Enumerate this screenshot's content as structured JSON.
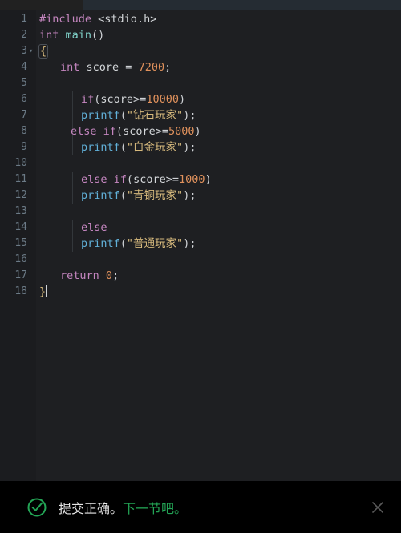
{
  "window": {
    "tab_active_label": "",
    "background": "#1e1f22",
    "gutter_background": "#1b1c1f"
  },
  "editor": {
    "language": "c",
    "cursor_line": 18,
    "lines": [
      {
        "number": "1",
        "fold": "",
        "indent": 0,
        "guides": [],
        "tokens": [
          {
            "text": "#include",
            "cls": "k-pre"
          },
          {
            "text": " ",
            "cls": "k-punc"
          },
          {
            "text": "<stdio.h>",
            "cls": "k-inc"
          }
        ]
      },
      {
        "number": "2",
        "fold": "",
        "indent": 0,
        "guides": [],
        "tokens": [
          {
            "text": "int",
            "cls": "k-kw"
          },
          {
            "text": " ",
            "cls": "k-punc"
          },
          {
            "text": "main",
            "cls": "k-type"
          },
          {
            "text": "()",
            "cls": "k-punc"
          }
        ]
      },
      {
        "number": "3",
        "fold": "▾",
        "indent": 0,
        "guides": [],
        "tokens": [
          {
            "text": "{",
            "cls": "k-br1 brace-box"
          }
        ]
      },
      {
        "number": "4",
        "fold": "",
        "indent": 1,
        "guides": [],
        "tokens": [
          {
            "text": "int",
            "cls": "k-kw"
          },
          {
            "text": " ",
            "cls": "k-punc"
          },
          {
            "text": "score",
            "cls": "k-id"
          },
          {
            "text": " = ",
            "cls": "k-punc"
          },
          {
            "text": "7200",
            "cls": "k-num"
          },
          {
            "text": ";",
            "cls": "k-punc"
          }
        ]
      },
      {
        "number": "5",
        "fold": "",
        "indent": 0,
        "guides": [],
        "tokens": []
      },
      {
        "number": "6",
        "fold": "",
        "indent": 2,
        "guides": [
          "g1"
        ],
        "tokens": [
          {
            "text": "if",
            "cls": "k-kw"
          },
          {
            "text": "(",
            "cls": "k-punc"
          },
          {
            "text": "score",
            "cls": "k-id"
          },
          {
            "text": ">=",
            "cls": "k-punc"
          },
          {
            "text": "10000",
            "cls": "k-num"
          },
          {
            "text": ")",
            "cls": "k-punc"
          }
        ]
      },
      {
        "number": "7",
        "fold": "",
        "indent": 2,
        "guides": [
          "g1"
        ],
        "tokens": [
          {
            "text": "printf",
            "cls": "k-fn"
          },
          {
            "text": "(",
            "cls": "k-punc"
          },
          {
            "text": "\"钻石玩家\"",
            "cls": "k-str"
          },
          {
            "text": ");",
            "cls": "k-punc"
          }
        ]
      },
      {
        "number": "8",
        "fold": "",
        "indent": 1.5,
        "guides": [
          "g1"
        ],
        "tokens": [
          {
            "text": "else",
            "cls": "k-kw"
          },
          {
            "text": " ",
            "cls": "k-punc"
          },
          {
            "text": "if",
            "cls": "k-kw"
          },
          {
            "text": "(",
            "cls": "k-punc"
          },
          {
            "text": "score",
            "cls": "k-id"
          },
          {
            "text": ">=",
            "cls": "k-punc"
          },
          {
            "text": "5000",
            "cls": "k-num"
          },
          {
            "text": ")",
            "cls": "k-punc"
          }
        ]
      },
      {
        "number": "9",
        "fold": "",
        "indent": 2,
        "guides": [
          "g1"
        ],
        "tokens": [
          {
            "text": "printf",
            "cls": "k-fn"
          },
          {
            "text": "(",
            "cls": "k-punc"
          },
          {
            "text": "\"白金玩家\"",
            "cls": "k-str"
          },
          {
            "text": ");",
            "cls": "k-punc"
          }
        ]
      },
      {
        "number": "10",
        "fold": "",
        "indent": 0,
        "guides": [],
        "tokens": []
      },
      {
        "number": "11",
        "fold": "",
        "indent": 2,
        "guides": [
          "g1"
        ],
        "tokens": [
          {
            "text": "else",
            "cls": "k-kw"
          },
          {
            "text": " ",
            "cls": "k-punc"
          },
          {
            "text": "if",
            "cls": "k-kw"
          },
          {
            "text": "(",
            "cls": "k-punc"
          },
          {
            "text": "score",
            "cls": "k-id"
          },
          {
            "text": ">=",
            "cls": "k-punc"
          },
          {
            "text": "1000",
            "cls": "k-num"
          },
          {
            "text": ")",
            "cls": "k-punc"
          }
        ]
      },
      {
        "number": "12",
        "fold": "",
        "indent": 2,
        "guides": [
          "g1"
        ],
        "tokens": [
          {
            "text": "printf",
            "cls": "k-fn"
          },
          {
            "text": "(",
            "cls": "k-punc"
          },
          {
            "text": "\"青铜玩家\"",
            "cls": "k-str"
          },
          {
            "text": ");",
            "cls": "k-punc"
          }
        ]
      },
      {
        "number": "13",
        "fold": "",
        "indent": 0,
        "guides": [],
        "tokens": []
      },
      {
        "number": "14",
        "fold": "",
        "indent": 2,
        "guides": [
          "g1"
        ],
        "tokens": [
          {
            "text": "else",
            "cls": "k-kw"
          }
        ]
      },
      {
        "number": "15",
        "fold": "",
        "indent": 2,
        "guides": [
          "g1"
        ],
        "tokens": [
          {
            "text": "printf",
            "cls": "k-fn"
          },
          {
            "text": "(",
            "cls": "k-punc"
          },
          {
            "text": "\"普通玩家\"",
            "cls": "k-str"
          },
          {
            "text": ");",
            "cls": "k-punc"
          }
        ]
      },
      {
        "number": "16",
        "fold": "",
        "indent": 0,
        "guides": [],
        "tokens": []
      },
      {
        "number": "17",
        "fold": "",
        "indent": 1,
        "guides": [],
        "tokens": [
          {
            "text": "return",
            "cls": "k-kw"
          },
          {
            "text": " ",
            "cls": "k-punc"
          },
          {
            "text": "0",
            "cls": "k-num"
          },
          {
            "text": ";",
            "cls": "k-punc"
          }
        ]
      },
      {
        "number": "18",
        "fold": "",
        "indent": 0,
        "guides": [],
        "cursor": true,
        "tokens": [
          {
            "text": "}",
            "cls": "k-br1"
          }
        ]
      }
    ]
  },
  "notification": {
    "icon": "check-circle-icon",
    "icon_color": "#23a455",
    "message": "提交正确。",
    "link_text": "下一节吧。",
    "link_color": "#23a455",
    "close_icon": "close-icon"
  }
}
